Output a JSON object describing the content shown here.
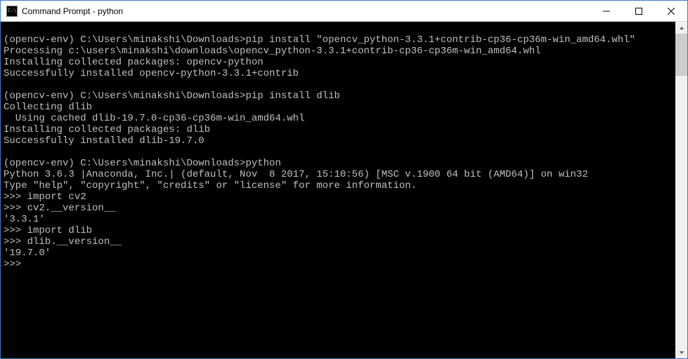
{
  "window": {
    "title": "Command Prompt - python"
  },
  "terminal": {
    "lines": [
      "",
      "(opencv-env) C:\\Users\\minakshi\\Downloads>pip install \"opencv_python-3.3.1+contrib-cp36-cp36m-win_amd64.whl\"",
      "Processing c:\\users\\minakshi\\downloads\\opencv_python-3.3.1+contrib-cp36-cp36m-win_amd64.whl",
      "Installing collected packages: opencv-python",
      "Successfully installed opencv-python-3.3.1+contrib",
      "",
      "(opencv-env) C:\\Users\\minakshi\\Downloads>pip install dlib",
      "Collecting dlib",
      "  Using cached dlib-19.7.0-cp36-cp36m-win_amd64.whl",
      "Installing collected packages: dlib",
      "Successfully installed dlib-19.7.0",
      "",
      "(opencv-env) C:\\Users\\minakshi\\Downloads>python",
      "Python 3.6.3 |Anaconda, Inc.| (default, Nov  8 2017, 15:10:56) [MSC v.1900 64 bit (AMD64)] on win32",
      "Type \"help\", \"copyright\", \"credits\" or \"license\" for more information.",
      ">>> import cv2",
      ">>> cv2.__version__",
      "'3.3.1'",
      ">>> import dlib",
      ">>> dlib.__version__",
      "'19.7.0'",
      ">>>"
    ]
  }
}
